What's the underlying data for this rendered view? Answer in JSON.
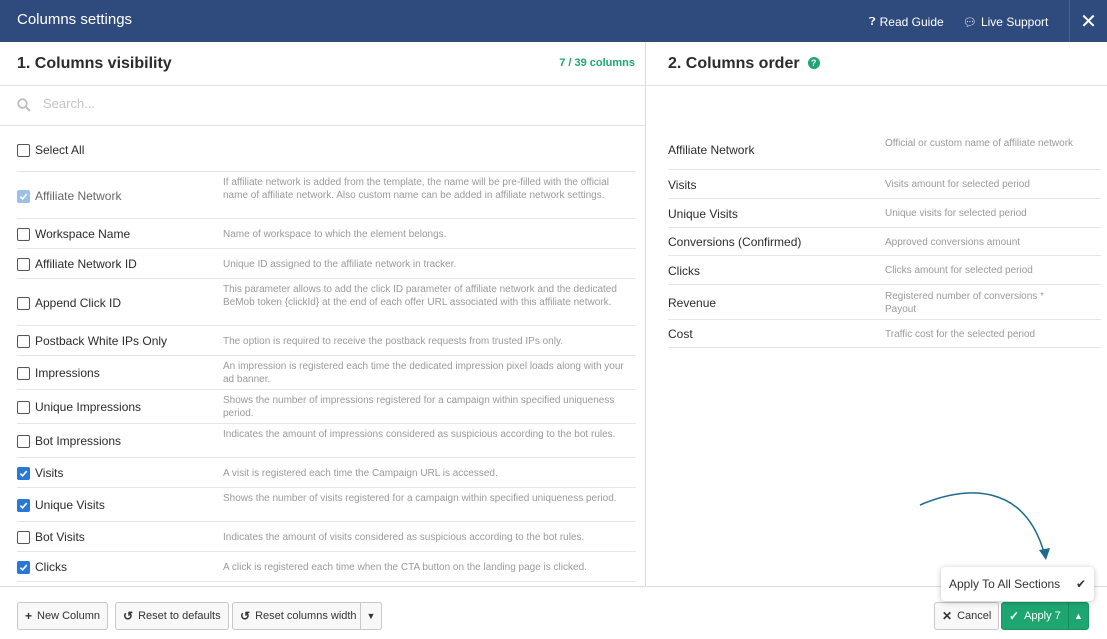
{
  "header": {
    "title": "Columns settings",
    "read_guide": "Read Guide",
    "live_support": "Live Support",
    "close": "✕"
  },
  "visibility": {
    "title": "1. Columns visibility",
    "count": "7 / 39 columns",
    "search_placeholder": "Search...",
    "select_all": "Select All",
    "rows": [
      {
        "label": "Affiliate Network",
        "state": "disabled",
        "desc": "If affiliate network is added from the template, the name will be pre-filled with the official name of affiliate network. Also custom name can be added in affiliate network settings."
      },
      {
        "label": "Workspace Name",
        "state": "off",
        "desc": "Name of workspace to which the element belongs."
      },
      {
        "label": "Affiliate Network ID",
        "state": "off",
        "desc": "Unique ID assigned to the affiliate network in tracker."
      },
      {
        "label": "Append Click ID",
        "state": "off",
        "desc": "This parameter allows to add the click ID parameter of affiliate network and the dedicated BeMob token {clickId} at the end of each offer URL associated with this affiliate network."
      },
      {
        "label": "Postback White IPs Only",
        "state": "off",
        "desc": "The option is required to receive the postback requests from trusted IPs only."
      },
      {
        "label": "Impressions",
        "state": "off",
        "desc": "An impression is registered each time the dedicated impression pixel loads along with your ad banner."
      },
      {
        "label": "Unique Impressions",
        "state": "off",
        "desc": "Shows the number of impressions registered for a campaign within specified uniqueness period."
      },
      {
        "label": "Bot Impressions",
        "state": "off",
        "desc": "Indicates the amount of impressions considered as suspicious according to the bot rules."
      },
      {
        "label": "Visits",
        "state": "on",
        "desc": "A visit is registered each time the Campaign URL is accessed."
      },
      {
        "label": "Unique Visits",
        "state": "on",
        "desc": "Shows the number of visits registered for a campaign within specified uniqueness period."
      },
      {
        "label": "Bot Visits",
        "state": "off",
        "desc": "Indicates the amount of visits considered as suspicious according to the bot rules."
      },
      {
        "label": "Clicks",
        "state": "on",
        "desc": "A click is registered each time when the CTA button on the landing page is clicked."
      }
    ]
  },
  "order": {
    "title": "2. Columns order",
    "help": "?",
    "rows": [
      {
        "name": "Affiliate Network",
        "desc": "Official or custom name of affiliate network"
      },
      {
        "name": "Visits",
        "desc": "Visits amount for selected period"
      },
      {
        "name": "Unique Visits",
        "desc": "Unique visits for selected period"
      },
      {
        "name": "Conversions (Confirmed)",
        "desc": "Approved conversions amount"
      },
      {
        "name": "Clicks",
        "desc": "Clicks amount for selected period"
      },
      {
        "name": "Revenue",
        "desc": "Registered number of conversions * Payout"
      },
      {
        "name": "Cost",
        "desc": "Traffic cost for the selected period"
      }
    ]
  },
  "footer": {
    "new_column": "New Column",
    "reset_defaults": "Reset to defaults",
    "reset_width": "Reset columns width",
    "cancel": "Cancel",
    "apply": "Apply 7",
    "apply_all": "Apply To All Sections"
  },
  "colors": {
    "header_bg": "#2f4a7d",
    "accent_green": "#1ea671",
    "checkbox_blue": "#2a78d6",
    "arrow": "#1f6a8a"
  }
}
